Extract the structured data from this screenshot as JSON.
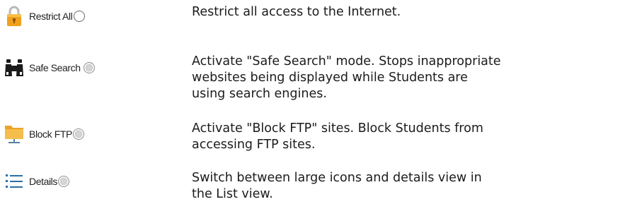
{
  "rows": [
    {
      "label": "Restrict All",
      "icon": "padlock-icon",
      "radio_state": "empty",
      "description": [
        "Restrict all access to the Internet."
      ]
    },
    {
      "label": "Safe Search",
      "icon": "binoculars-icon",
      "radio_state": "dim",
      "description": [
        "Activate \"Safe Search\" mode. Stops inappropriate",
        "websites being displayed while Students are",
        "using search engines."
      ]
    },
    {
      "label": "Block FTP",
      "icon": "ftp-folder-icon",
      "radio_state": "dim",
      "description": [
        "Activate \"Block FTP\" sites. Block Students from",
        "accessing FTP sites."
      ]
    },
    {
      "label": "Details",
      "icon": "list-details-icon",
      "radio_state": "dim",
      "description": [
        "Switch between large icons and details view in",
        "the List view."
      ]
    }
  ],
  "colors": {
    "padlock_body": "#f0a01e",
    "folder": "#f2b43a",
    "list_icon": "#2b6fa8",
    "text": "#1b1b1b"
  }
}
